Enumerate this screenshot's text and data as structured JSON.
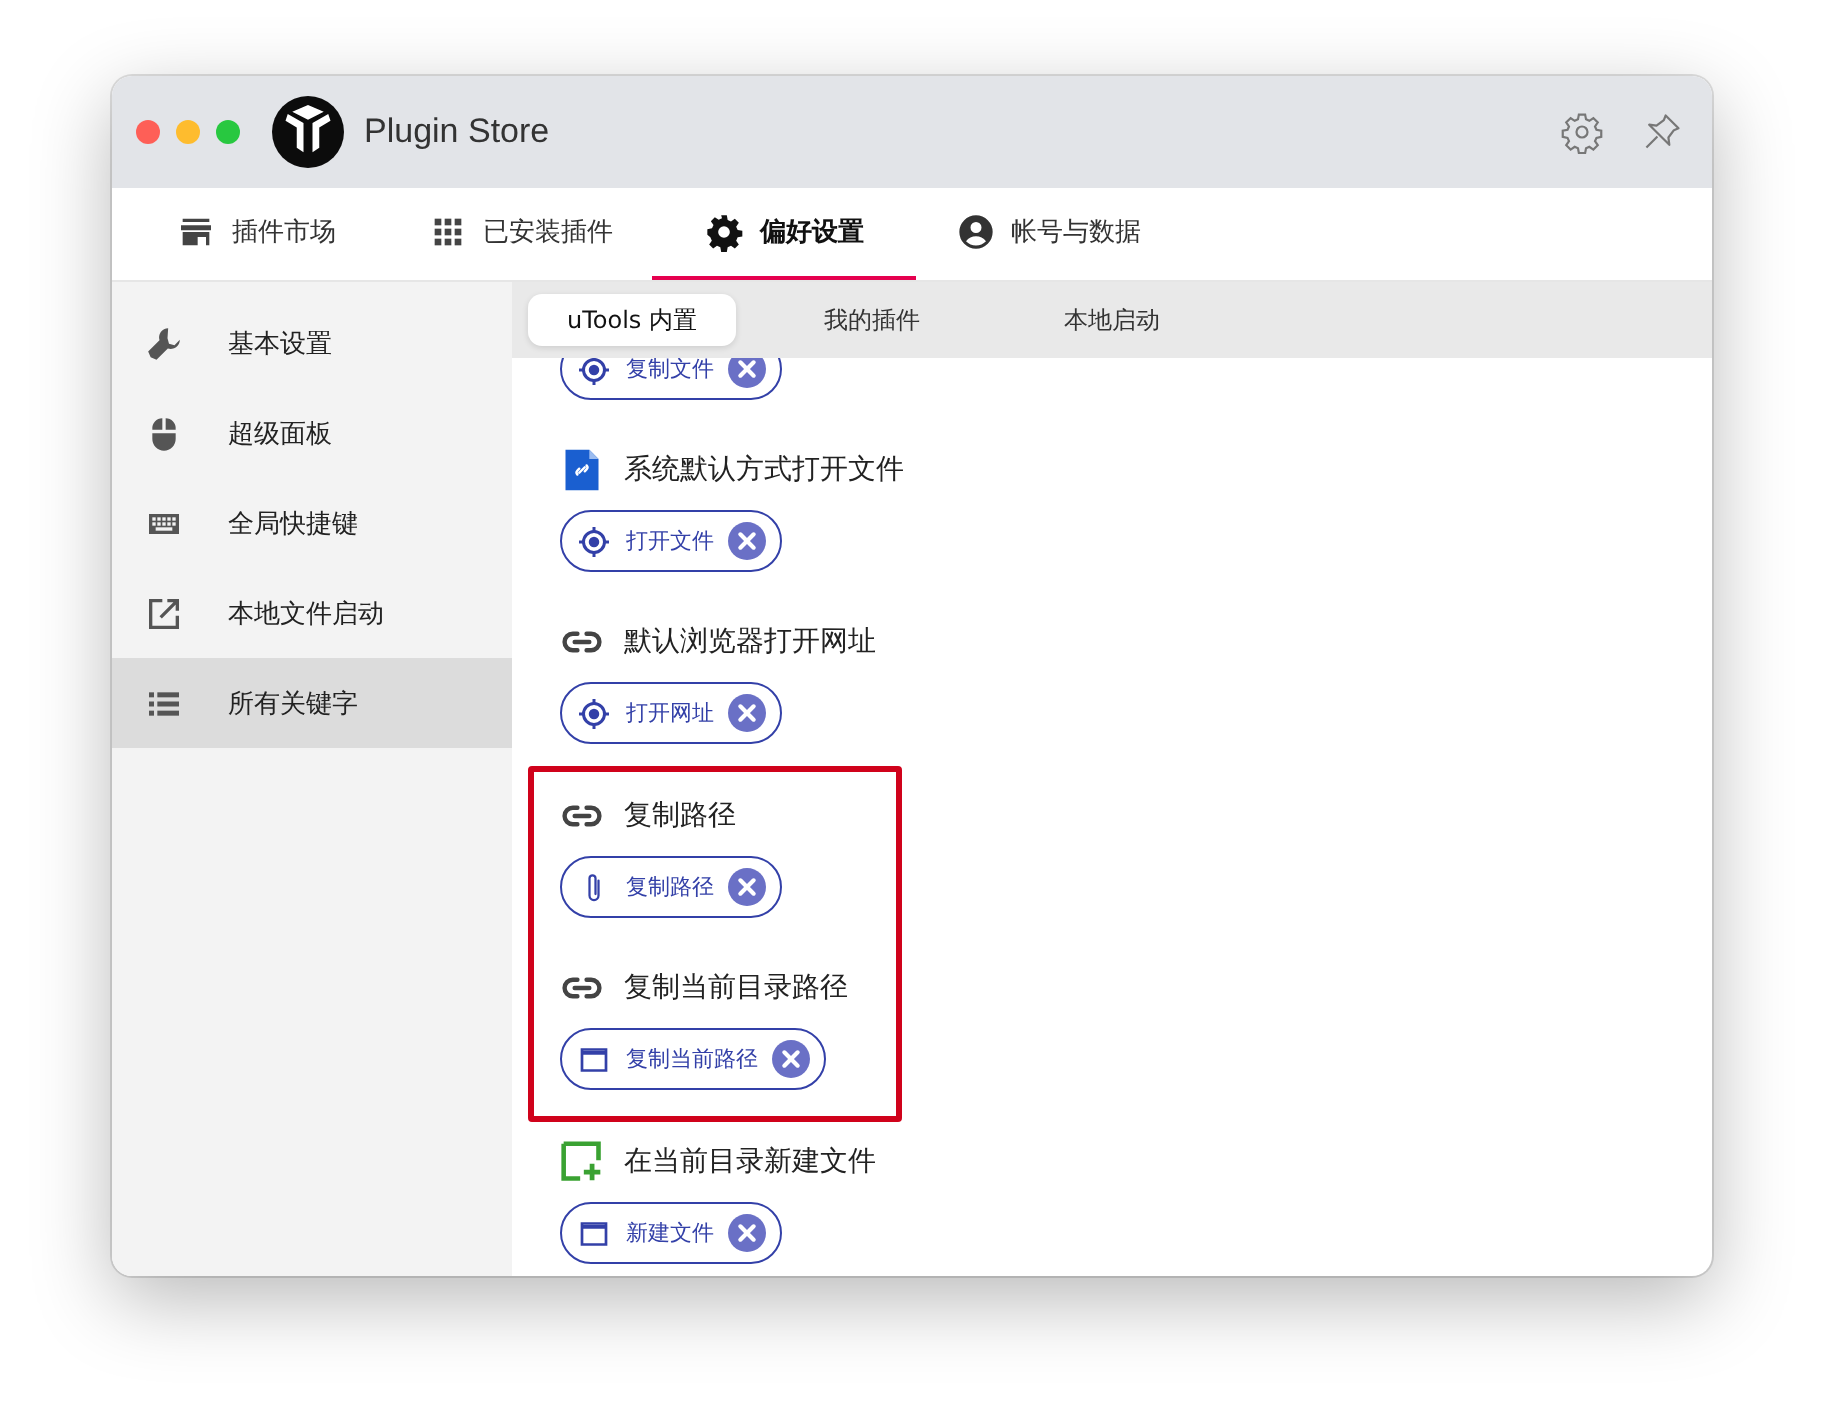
{
  "window": {
    "title": "Plugin Store"
  },
  "tabs": [
    {
      "label": "插件市场",
      "kind": "store",
      "selected": false
    },
    {
      "label": "已安装插件",
      "kind": "grid",
      "selected": false
    },
    {
      "label": "偏好设置",
      "kind": "gear",
      "selected": true
    },
    {
      "label": "帐号与数据",
      "kind": "account",
      "selected": false
    }
  ],
  "sidebar": {
    "items": [
      {
        "label": "基本设置",
        "kind": "wrench",
        "selected": false
      },
      {
        "label": "超级面板",
        "kind": "mouse",
        "selected": false
      },
      {
        "label": "全局快捷键",
        "kind": "keyboard",
        "selected": false
      },
      {
        "label": "本地文件启动",
        "kind": "external",
        "selected": false
      },
      {
        "label": "所有关键字",
        "kind": "list",
        "selected": true
      }
    ]
  },
  "subtabs": [
    {
      "label": "uTools 内置",
      "selected": true
    },
    {
      "label": "我的插件",
      "selected": false
    },
    {
      "label": "本地启动",
      "selected": false
    }
  ],
  "keyword_groups": [
    {
      "highlighted": false,
      "items": [
        {
          "chips": [
            {
              "label": "复制文件",
              "kind": "target"
            }
          ]
        },
        {
          "title": "系统默认方式打开文件",
          "kind": "file-link",
          "chips": [
            {
              "label": "打开文件",
              "kind": "target"
            }
          ]
        },
        {
          "title": "默认浏览器打开网址",
          "kind": "link",
          "chips": [
            {
              "label": "打开网址",
              "kind": "target"
            }
          ]
        }
      ]
    },
    {
      "highlighted": true,
      "items": [
        {
          "title": "复制路径",
          "kind": "link",
          "chips": [
            {
              "label": "复制路径",
              "kind": "paperclip"
            }
          ]
        },
        {
          "title": "复制当前目录路径",
          "kind": "link",
          "chips": [
            {
              "label": "复制当前路径",
              "kind": "window"
            }
          ]
        }
      ]
    },
    {
      "highlighted": false,
      "items": [
        {
          "title": "在当前目录新建文件",
          "kind": "new-file",
          "chips": [
            {
              "label": "新建文件",
              "kind": "window"
            }
          ]
        }
      ]
    }
  ]
}
